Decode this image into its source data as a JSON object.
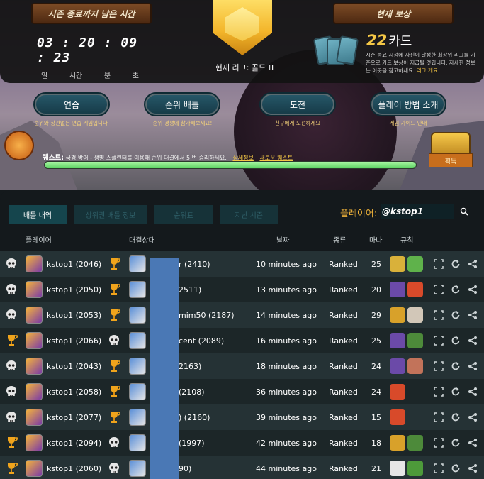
{
  "top": {
    "timer_title": "시즌 종료까지 남은 시간",
    "countdown": "03 : 20 : 09 : 23",
    "countdown_units": [
      "일",
      "시간",
      "분",
      "초"
    ],
    "league_label": "현재 리그: 골드 Ⅲ",
    "reward_title": "현재 보상",
    "card_count": "22",
    "card_unit": "카드",
    "reward_desc": "시즌 종료 시점에 자신이 달성한 최상위 리그를 기준으로 카드 보상이 지급될 것입니다. 자세한 정보는 이곳을 참고하세요: ",
    "reward_link": "리그 개요",
    "modes": [
      {
        "label": "연습",
        "desc": "순위와 상관없는 연습 게임입니다"
      },
      {
        "label": "순위 배틀",
        "desc": "순위 경쟁에 참가해보세요!"
      },
      {
        "label": "도전",
        "desc": "친구에게 도전하세요"
      },
      {
        "label": "플레이 방법 소개",
        "desc": "게임 가이드 안내"
      }
    ],
    "quest_heading": "퀘스트:",
    "quest_text": "국경 방어 - 생명 스플린터를 이용해 순위 대결에서 5 번 승리하세요.",
    "quest_detail_link": "상세정보",
    "quest_new_link": "새로운 퀘스트",
    "quest_progress": 1.0,
    "claim_label": "획득"
  },
  "tabs": [
    "배틀 내역",
    "상위권 배틀 정보",
    "순위표",
    "지난 시즌"
  ],
  "player_label": "플레이어:",
  "player_value": "@kstop1",
  "columns": [
    "플레이어",
    "대결상대",
    "날짜",
    "종류",
    "마나",
    "규칙"
  ],
  "colors": {
    "accent": "#f1b43a",
    "row_odd": "#253235",
    "row_even": "#1c2628",
    "censor": "#4a78b5"
  },
  "rows": [
    {
      "player_result": "skull-icon",
      "player": "kstop1 (2046)",
      "opponent_result": "trophy-icon",
      "opponent": "r (2410)",
      "date": "10 minutes ago",
      "type": "Ranked",
      "mana": "25"
    },
    {
      "player_result": "skull-icon",
      "player": "kstop1 (2050)",
      "opponent_result": "trophy-icon",
      "opponent": "2511)",
      "date": "13 minutes ago",
      "type": "Ranked",
      "mana": "20"
    },
    {
      "player_result": "skull-icon",
      "player": "kstop1 (2053)",
      "opponent_result": "trophy-icon",
      "opponent": "mim50 (2187)",
      "date": "14 minutes ago",
      "type": "Ranked",
      "mana": "29"
    },
    {
      "player_result": "trophy-icon",
      "player": "kstop1 (2066)",
      "opponent_result": "skull-icon",
      "opponent": "cent (2089)",
      "date": "16 minutes ago",
      "type": "Ranked",
      "mana": "25"
    },
    {
      "player_result": "skull-icon",
      "player": "kstop1 (2043)",
      "opponent_result": "trophy-icon",
      "opponent": "2163)",
      "date": "18 minutes ago",
      "type": "Ranked",
      "mana": "24"
    },
    {
      "player_result": "skull-icon",
      "player": "kstop1 (2058)",
      "opponent_result": "trophy-icon",
      "opponent": "(2108)",
      "date": "36 minutes ago",
      "type": "Ranked",
      "mana": "24"
    },
    {
      "player_result": "skull-icon",
      "player": "kstop1 (2077)",
      "opponent_result": "trophy-icon",
      "opponent": ") (2160)",
      "date": "39 minutes ago",
      "type": "Ranked",
      "mana": "15"
    },
    {
      "player_result": "trophy-icon",
      "player": "kstop1 (2094)",
      "opponent_result": "skull-icon",
      "opponent": "(1997)",
      "date": "42 minutes ago",
      "type": "Ranked",
      "mana": "18"
    },
    {
      "player_result": "trophy-icon",
      "player": "kstop1 (2060)",
      "opponent_result": "skull-icon",
      "opponent": "90)",
      "date": "44 minutes ago",
      "type": "Ranked",
      "mana": "21"
    }
  ]
}
